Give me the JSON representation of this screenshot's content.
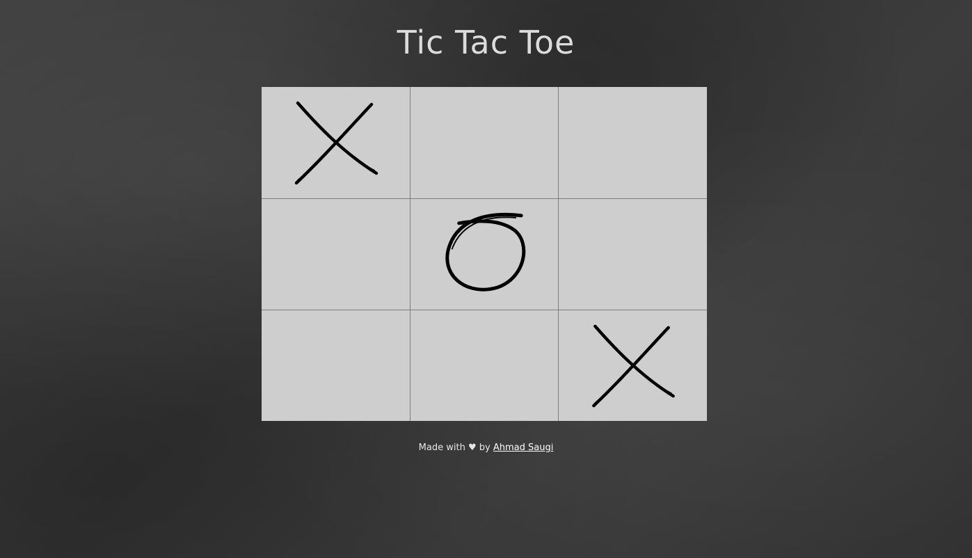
{
  "title": "Tic Tac Toe",
  "board": [
    [
      "X",
      "",
      ""
    ],
    [
      "",
      "O",
      ""
    ],
    [
      "",
      "",
      "X"
    ]
  ],
  "colors": {
    "board_bg": "#cecece",
    "grid_line": "#7d7d7d",
    "mark": "#000000",
    "title": "#dcdcdc"
  },
  "footer": {
    "made_with": "Made with",
    "heart": "♥",
    "by": "by",
    "author": "Ahmad Saugi"
  }
}
